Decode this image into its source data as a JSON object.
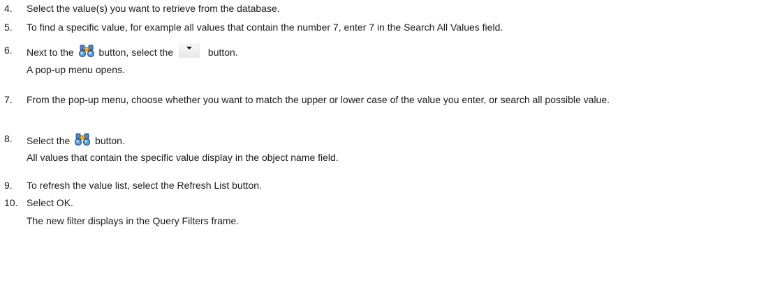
{
  "steps": [
    {
      "num": "4.",
      "text": "Select the value(s) you want to retrieve from the database."
    },
    {
      "num": "5.",
      "text": "To find a specific value, for example all values that contain the number 7, enter 7 in the Search All Values field."
    },
    {
      "num": "6.",
      "text_a": "Next to the",
      "text_b": "button, select the",
      "text_c": "button.",
      "note": "A pop-up menu opens."
    },
    {
      "num": "7.",
      "text": "From the pop-up menu, choose whether you want to match the upper or lower case of the value you enter, or search all possible value."
    },
    {
      "num": "8.",
      "text_a": "Select the",
      "text_b": "button.",
      "note": "All values that contain the specific value display in the object name field."
    },
    {
      "num": "9.",
      "text": "To refresh the value list, select the Refresh List button."
    },
    {
      "num": "10.",
      "text": "Select OK.",
      "note": "The new filter displays in the Query Filters frame."
    }
  ],
  "icons": {
    "search": "binoculars-icon",
    "dropdown": "dropdown-arrow-icon"
  }
}
